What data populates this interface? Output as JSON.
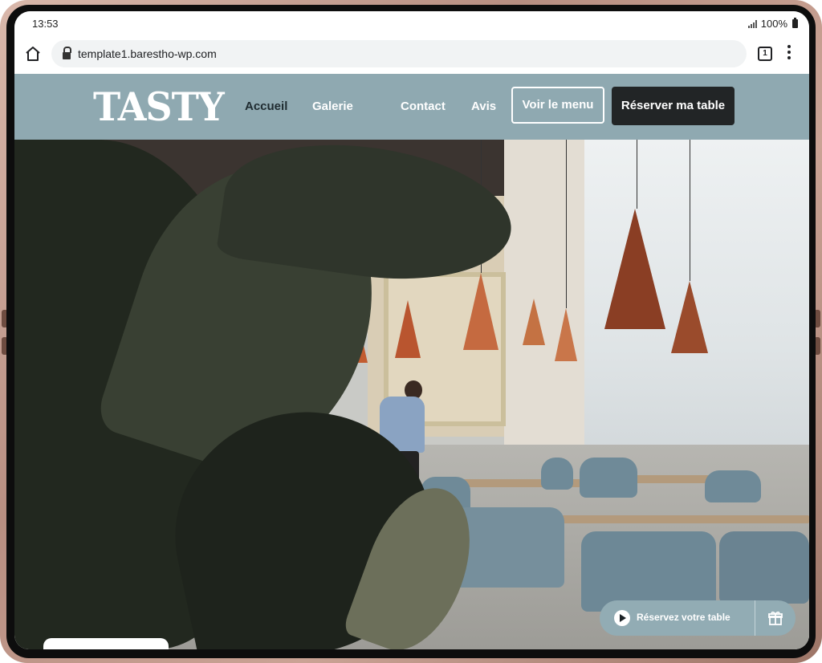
{
  "status_bar": {
    "time": "13:53",
    "battery": "100%"
  },
  "browser": {
    "url": "template1.barestho-wp.com",
    "tab_count": "1"
  },
  "site": {
    "logo": "TASTY",
    "nav": [
      {
        "label": "Accueil"
      },
      {
        "label": "Galerie"
      },
      {
        "label": "Contact"
      },
      {
        "label": "Avis"
      }
    ],
    "menu_button": "Voir le menu",
    "reserve_button": "Réserver ma table"
  },
  "floating": {
    "reserve_label": "Réservez votre table"
  },
  "colors": {
    "header_bg": "#8fa9b1",
    "dark_button": "#222526",
    "pill_bg": "#92acb4"
  },
  "icons": [
    "home-icon",
    "lock-icon",
    "tabs-icon",
    "more-vert-icon",
    "signal-icon",
    "battery-icon",
    "play-icon",
    "gift-icon"
  ]
}
